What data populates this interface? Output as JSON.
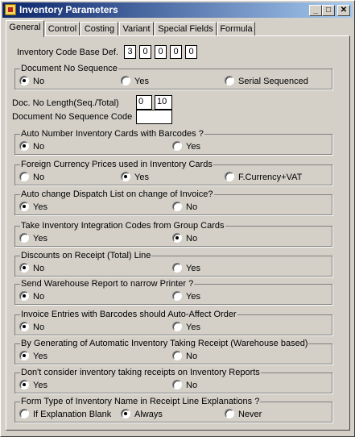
{
  "window": {
    "title": "Inventory Parameters"
  },
  "titlebar_buttons": {
    "minimize": "_",
    "maximize": "□",
    "close": "✕"
  },
  "tabs": [
    {
      "label": "General",
      "active": true
    },
    {
      "label": "Control",
      "active": false
    },
    {
      "label": "Costing",
      "active": false
    },
    {
      "label": "Variant",
      "active": false
    },
    {
      "label": "Special Fields",
      "active": false
    },
    {
      "label": "Formula",
      "active": false
    }
  ],
  "code_base": {
    "label": "Inventory Code Base Def.",
    "digits": [
      "3",
      "0",
      "0",
      "0",
      "0"
    ]
  },
  "doc_no_length": {
    "label": "Doc. No Length(Seq./Total)",
    "seq": "0",
    "total": "10"
  },
  "doc_seq_code": {
    "label": "Document No Sequence Code",
    "value": ""
  },
  "groups": [
    {
      "title": "Document No Sequence",
      "options": [
        {
          "label": "No",
          "selected": true
        },
        {
          "label": "Yes",
          "selected": false
        },
        {
          "label": "Serial Sequenced",
          "selected": false
        }
      ]
    },
    {
      "title": "Auto Number Inventory Cards with Barcodes ?",
      "options": [
        {
          "label": "No",
          "selected": true
        },
        {
          "label": "Yes",
          "selected": false
        }
      ]
    },
    {
      "title": "Foreign Currency Prices used in Inventory Cards",
      "options": [
        {
          "label": "No",
          "selected": false
        },
        {
          "label": "Yes",
          "selected": true
        },
        {
          "label": "F.Currency+VAT",
          "selected": false
        }
      ]
    },
    {
      "title": "Auto change Dispatch List on change of Invoice?",
      "options": [
        {
          "label": "Yes",
          "selected": true
        },
        {
          "label": "No",
          "selected": false
        }
      ]
    },
    {
      "title": "Take Inventory Integration Codes from Group Cards",
      "options": [
        {
          "label": "Yes",
          "selected": false
        },
        {
          "label": "No",
          "selected": true
        }
      ]
    },
    {
      "title": "Discounts on Receipt (Total) Line",
      "options": [
        {
          "label": "No",
          "selected": true
        },
        {
          "label": "Yes",
          "selected": false
        }
      ]
    },
    {
      "title": "Send Warehouse Report to narrow Printer ?",
      "options": [
        {
          "label": "No",
          "selected": true
        },
        {
          "label": "Yes",
          "selected": false
        }
      ]
    },
    {
      "title": "Invoice Entries with Barcodes should Auto-Affect Order",
      "options": [
        {
          "label": "No",
          "selected": true
        },
        {
          "label": "Yes",
          "selected": false
        }
      ]
    },
    {
      "title": "By Generating of Automatic Inventory Taking Receipt (Warehouse based)",
      "options": [
        {
          "label": "Yes",
          "selected": true
        },
        {
          "label": "No",
          "selected": false
        }
      ]
    },
    {
      "title": "Don't consider inventory taking receipts on Inventory Reports",
      "options": [
        {
          "label": "Yes",
          "selected": true
        },
        {
          "label": "No",
          "selected": false
        }
      ]
    },
    {
      "title": "Form Type of Inventory Name in Receipt Line Explanations ?",
      "options": [
        {
          "label": "If Explanation Blank",
          "selected": false
        },
        {
          "label": "Always",
          "selected": true
        },
        {
          "label": "Never",
          "selected": false
        }
      ]
    }
  ]
}
